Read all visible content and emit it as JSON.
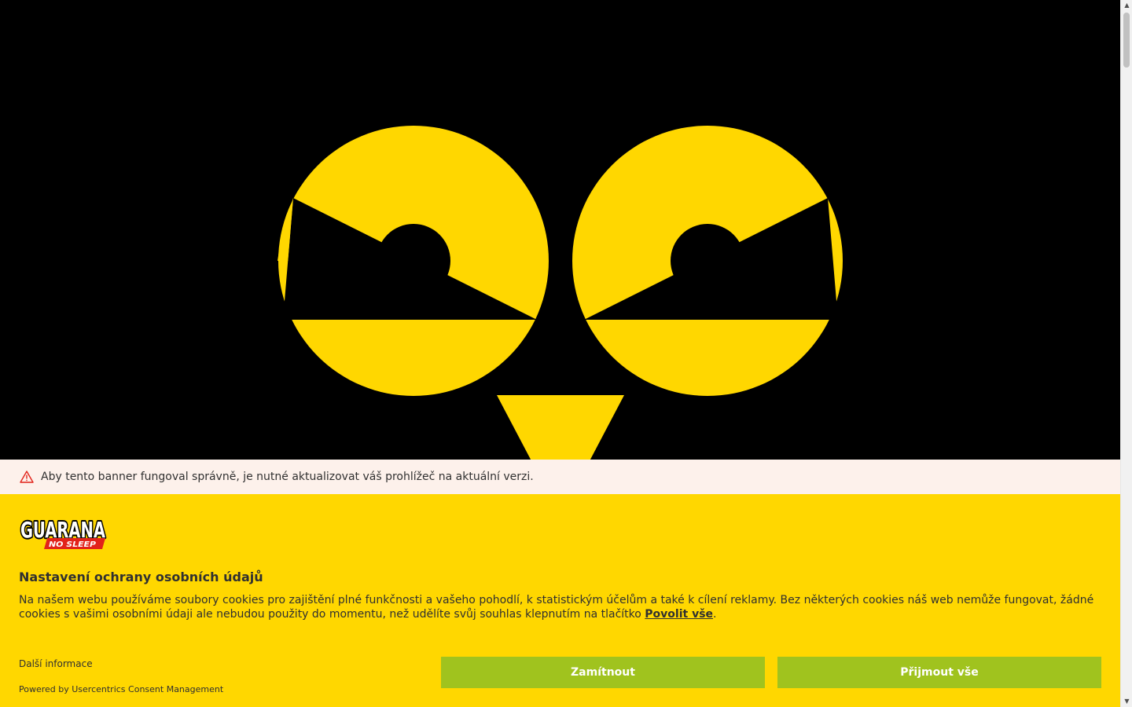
{
  "warning": {
    "text": "Aby tento banner fungoval správně, je nutné aktualizovat váš prohlížeč na aktuální verzi.",
    "icon": "warning-triangle-icon"
  },
  "brand": {
    "logo_main": "GUARANA",
    "logo_sub": "NO SLEEP",
    "colors": {
      "yellow": "#FFD700",
      "green": "#A0C31E",
      "red": "#E2231A",
      "black": "#000000"
    }
  },
  "consent": {
    "title": "Nastavení ochrany osobních údajů",
    "description_before": "Na našem webu používáme soubory cookies pro zajištění plné funkčnosti a vašeho pohodlí, k statistickým účelům a také k cílení reklamy. Bez některých cookies náš web nemůže fungovat, žádné cookies s vašimi osobními údaji ale nebudou použity do momentu, než udělíte svůj souhlas klepnutím na tlačítko ",
    "description_link": "Povolit vše",
    "description_after": ".",
    "more_info": "Další informace",
    "powered_by": "Powered by Usercentrics Consent Management",
    "deny_label": "Zamítnout",
    "accept_label": "Přijmout vše"
  }
}
